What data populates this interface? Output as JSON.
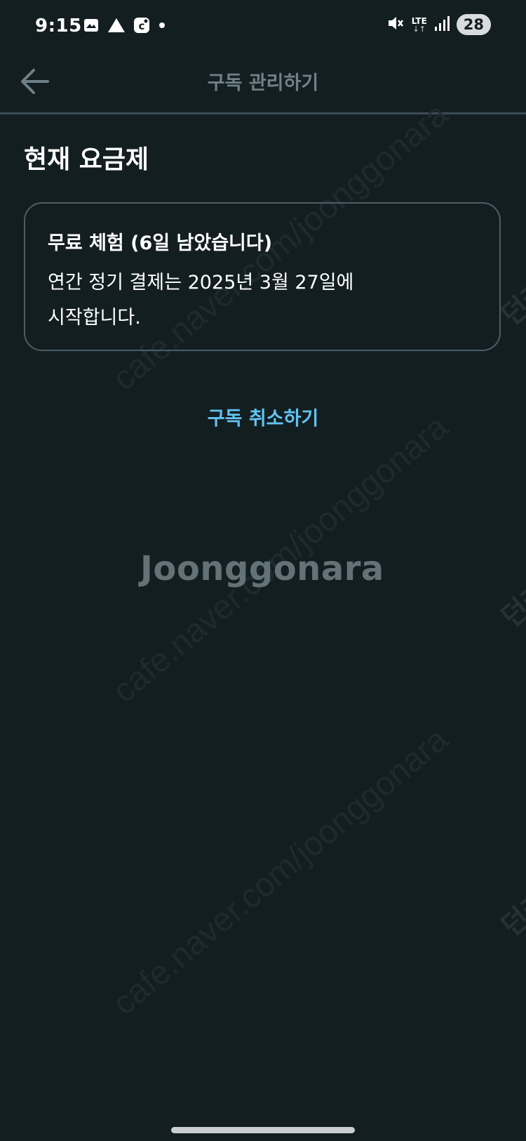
{
  "status_bar": {
    "time": "9:15",
    "network": "LTE",
    "network_arrows": "↓↑",
    "battery": "28"
  },
  "app_bar": {
    "title": "구독 관리하기"
  },
  "current_plan": {
    "section_title": "현재 요금제",
    "plan_name": "무료 체험 (6일 남았습니다)",
    "description_line1": "연간 정기 결제는 2025년 3월 27일에",
    "description_line2": "시작합니다."
  },
  "actions": {
    "cancel_subscription": "구독 취소하기"
  },
  "watermark": {
    "brand": "Joonggonara",
    "url": "cafe.naver.com/joonggonara",
    "side_text": "던커"
  },
  "colors": {
    "background": "#131e21",
    "accent_link": "#62c3f1",
    "card_border": "#4a5f67"
  }
}
